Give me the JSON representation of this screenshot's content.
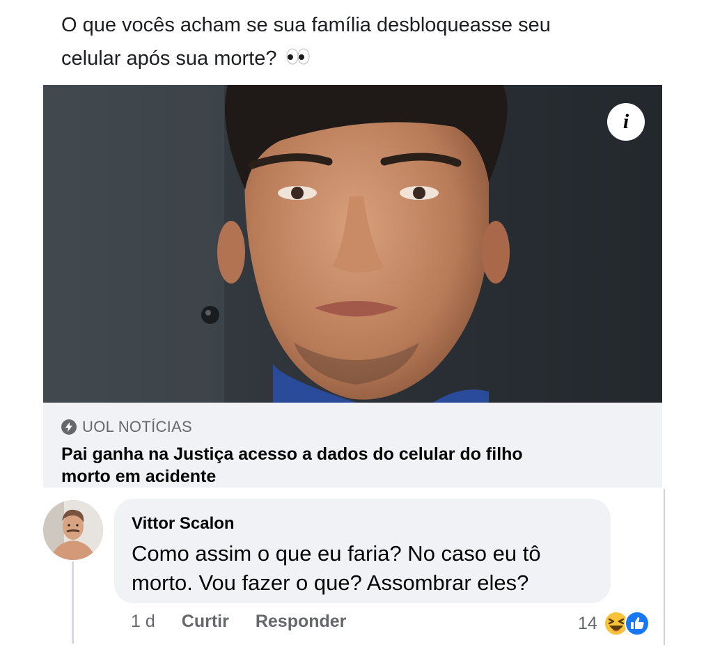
{
  "post": {
    "text_line1": "O que vocês acham se sua família desbloqueasse seu",
    "text_line2": "celular após sua morte?"
  },
  "link_card": {
    "source": "UOL NOTÍCIAS",
    "headline_line1": "Pai ganha na Justiça acesso a dados do celular do filho",
    "headline_line2": "morto em acidente",
    "info_label": "i"
  },
  "comment": {
    "author": "Vittor Scalon",
    "text_line1": "Como assim o que eu faria? No caso eu tô",
    "text_line2": "morto. Vou fazer o que? Assombrar eles?",
    "time": "1 d",
    "like_label": "Curtir",
    "reply_label": "Responder",
    "reaction_count": "14",
    "reactions": [
      "haha-icon",
      "like-icon"
    ]
  },
  "colors": {
    "meta_gray": "#65676b",
    "card_bg": "#f0f2f5",
    "like_blue": "#1877f2",
    "haha_yellow": "#f7c33b"
  }
}
